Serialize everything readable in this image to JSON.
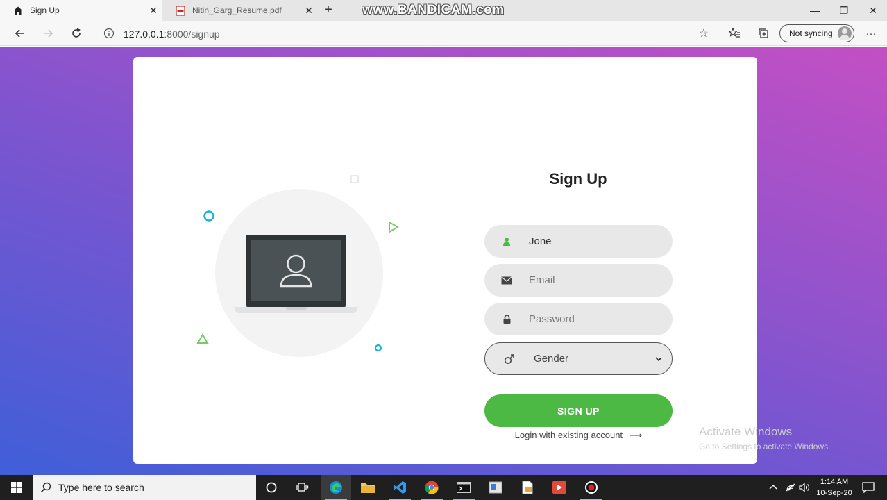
{
  "browser": {
    "tabs": [
      {
        "label": "Sign Up",
        "active": true,
        "close": "✕"
      },
      {
        "label": "Nitin_Garg_Resume.pdf",
        "active": false,
        "close": "✕"
      }
    ],
    "new_tab": "+",
    "watermark": "www.BANDICAM.com",
    "window_controls": {
      "minimize": "—",
      "maximize": "❐",
      "close": "✕"
    },
    "address": {
      "host": "127.0.0.1",
      "path": ":8000/signup"
    },
    "sync_label": "Not syncing",
    "more": "···"
  },
  "signup": {
    "title": "Sign Up",
    "name_value": "Jone",
    "email_placeholder": "Email",
    "password_placeholder": "Password",
    "gender_value": "Gender",
    "submit_label": "SIGN UP",
    "login_link": "Login with existing account"
  },
  "activation": {
    "line1": "Activate Windows",
    "line2": "Go to Settings to activate Windows."
  },
  "taskbar": {
    "search_placeholder": "Type here to search",
    "time": "1:14 AM",
    "date": "10-Sep-20"
  },
  "colors": {
    "accent_green": "#4cb944",
    "gradient_start": "#3f5fd8",
    "gradient_end": "#c44fc4",
    "deco_cyan": "#17b5d3",
    "deco_green": "#7cc96b"
  }
}
